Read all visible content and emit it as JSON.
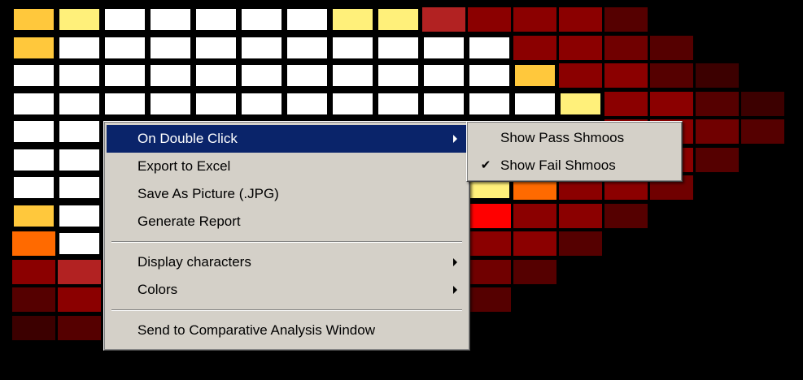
{
  "context_menu": {
    "items": [
      {
        "label": "On Double Click",
        "has_submenu": true,
        "highlighted": true
      },
      {
        "label": "Export to Excel",
        "has_submenu": false
      },
      {
        "label": "Save As Picture (.JPG)",
        "has_submenu": false
      },
      {
        "label": "Generate Report",
        "has_submenu": false
      },
      {
        "label": "Display characters",
        "has_submenu": true
      },
      {
        "label": "Colors",
        "has_submenu": true
      },
      {
        "label": "Send to Comparative Analysis Window",
        "has_submenu": false
      }
    ]
  },
  "submenu": {
    "items": [
      {
        "label": "Show Pass Shmoos",
        "checked": false
      },
      {
        "label": "Show Fail Shmoos",
        "checked": true
      }
    ]
  },
  "icons": {
    "check": "✔"
  },
  "colors": {
    "background": "#000000",
    "menu_bg": "#d4d0c8",
    "highlight": "#0a246a",
    "pass": "#ffffff",
    "yellow": "#fff07a",
    "amber": "#ffc83c",
    "orange": "#ff6a00",
    "red": "#ff0000",
    "brick": "#b22222",
    "dark_red_1": "#8b0000",
    "dark_red_2": "#700000",
    "dark_red_3": "#550000",
    "dark_red_4": "#3c0000"
  },
  "shmoo_grid": {
    "rows": [
      [
        "amber",
        "yellow",
        "pass",
        "pass",
        "pass",
        "pass",
        "pass",
        "yellow",
        "yellow",
        "brick",
        "dark_red_1",
        "dark_red_1",
        "dark_red_1",
        "dark_red_3"
      ],
      [
        "amber",
        "pass",
        "pass",
        "pass",
        "pass",
        "pass",
        "pass",
        "pass",
        "pass",
        "pass",
        "pass",
        "dark_red_1",
        "dark_red_1",
        "dark_red_2",
        "dark_red_3"
      ],
      [
        "pass",
        "pass",
        "pass",
        "pass",
        "pass",
        "pass",
        "pass",
        "pass",
        "pass",
        "pass",
        "pass",
        "amber",
        "dark_red_1",
        "dark_red_1",
        "dark_red_3",
        "dark_red_4"
      ],
      [
        "pass",
        "pass",
        "pass",
        "pass",
        "pass",
        "pass",
        "pass",
        "pass",
        "pass",
        "pass",
        "pass",
        "pass",
        "yellow",
        "dark_red_1",
        "dark_red_1",
        "dark_red_3",
        "dark_red_4"
      ],
      [
        "pass",
        "pass",
        "pass",
        "pass",
        "pass",
        "pass",
        "pass",
        "pass",
        "pass",
        "pass",
        "pass",
        "pass",
        "pass",
        "dark_red_1",
        "dark_red_1",
        "dark_red_2",
        "dark_red_3"
      ],
      [
        "pass",
        "pass",
        "pass",
        "pass",
        "pass",
        "pass",
        "pass",
        "pass",
        "pass",
        "pass",
        "pass",
        "pass",
        "pass",
        "dark_red_1",
        "dark_red_1",
        "dark_red_3"
      ],
      [
        "pass",
        "pass",
        "pass",
        "pass",
        "pass",
        "pass",
        "pass",
        "pass",
        "pass",
        "pass",
        "yellow",
        "orange",
        "dark_red_1",
        "dark_red_1",
        "dark_red_2"
      ],
      [
        "amber",
        "pass",
        "pass",
        "pass",
        "pass",
        "pass",
        "pass",
        "pass",
        "pass",
        "dark_red_1",
        "red",
        "dark_red_1",
        "dark_red_1",
        "dark_red_3"
      ],
      [
        "orange",
        "pass",
        "pass",
        "pass",
        "pass",
        "pass",
        "pass",
        "pass",
        "pass",
        "dark_red_1",
        "dark_red_1",
        "dark_red_1",
        "dark_red_3"
      ],
      [
        "dark_red_1",
        "brick",
        "pass",
        "pass",
        "pass",
        "pass",
        "pass",
        "pass",
        "pass",
        "dark_red_1",
        "dark_red_2",
        "dark_red_3"
      ],
      [
        "dark_red_3",
        "dark_red_1",
        "pass",
        "pass",
        "pass",
        "pass",
        "pass",
        "pass",
        "pass",
        "dark_red_2",
        "dark_red_3"
      ],
      [
        "dark_red_4",
        "dark_red_3"
      ]
    ]
  }
}
